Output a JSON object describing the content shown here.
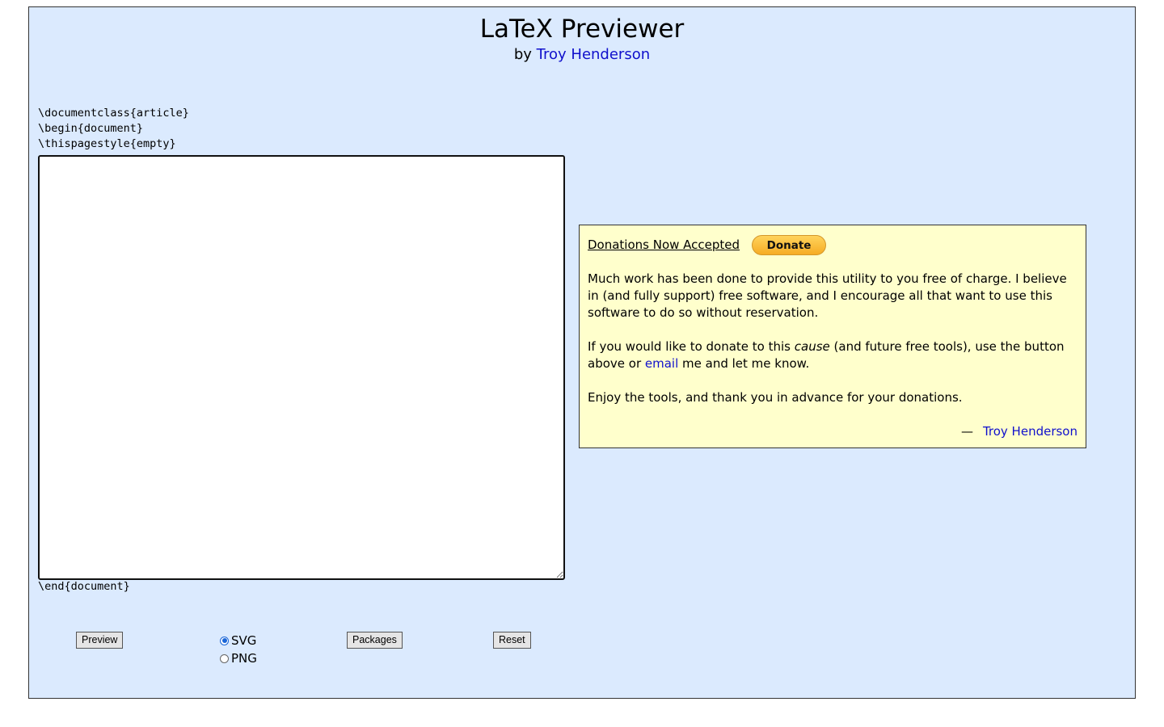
{
  "header": {
    "title": "LaTeX Previewer",
    "by_prefix": "by",
    "author": "Troy Henderson"
  },
  "editor": {
    "preamble": [
      "\\documentclass{article}",
      "\\begin{document}",
      "\\thispagestyle{empty}"
    ],
    "body_value": "",
    "postamble": "\\end{document}"
  },
  "controls": {
    "preview_label": "Preview",
    "format_options": [
      {
        "label": "SVG",
        "checked": true
      },
      {
        "label": "PNG",
        "checked": false
      }
    ],
    "packages_label": "Packages",
    "reset_label": "Reset"
  },
  "donations": {
    "heading": "Donations Now Accepted",
    "button_label": "Donate",
    "paragraph1": "Much work has been done to provide this utility to you free of charge. I believe in (and fully support) free software, and I encourage all that want to use this software to do so without reservation.",
    "paragraph2_before": "If you would like to donate to this ",
    "paragraph2_emphasis": "cause",
    "paragraph2_middle": " (and future free tools), use the button above or ",
    "paragraph2_link": "email",
    "paragraph2_after": " me and let me know.",
    "paragraph3": "Enjoy the tools, and thank you in advance for your donations.",
    "signature_dash": "—",
    "signature_name": "Troy Henderson"
  },
  "colors": {
    "page_background": "#dbeafe",
    "donation_background": "#ffffcc",
    "link": "#1010cc",
    "donate_button": "#f6ac24"
  }
}
